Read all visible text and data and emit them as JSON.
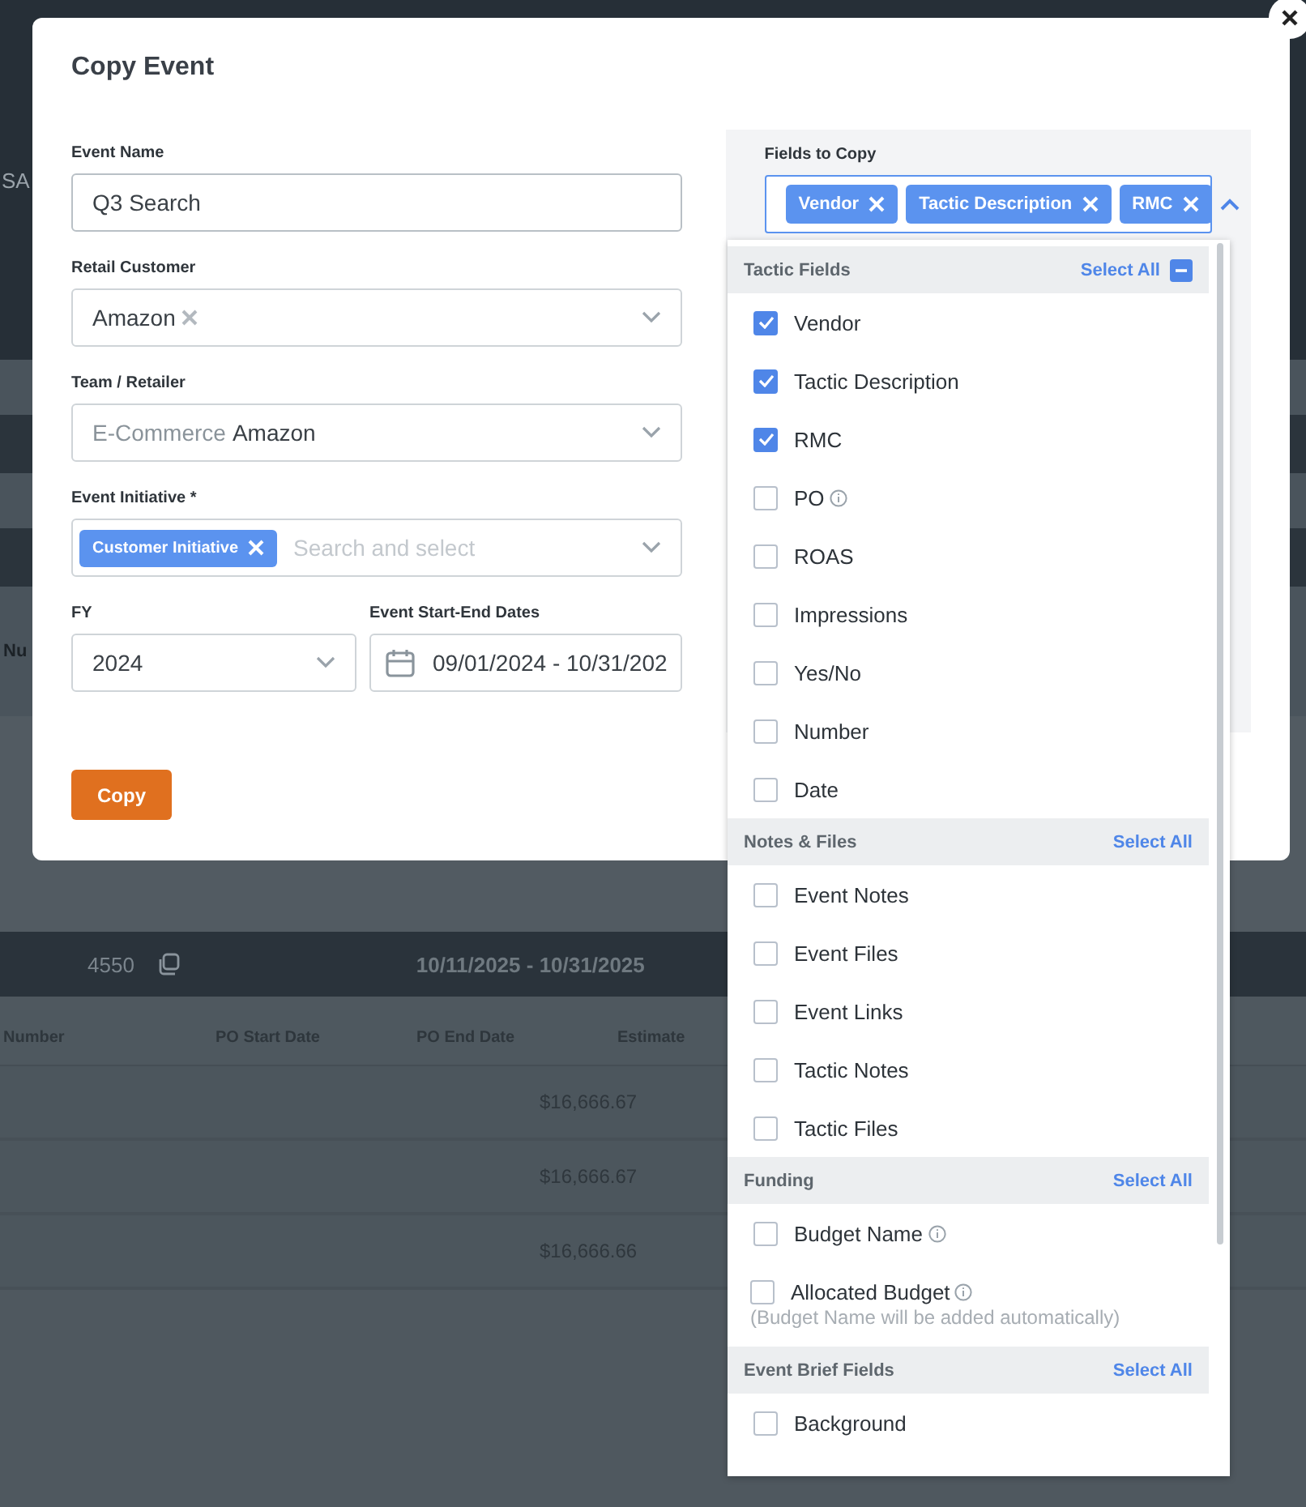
{
  "background": {
    "header_text": "SA",
    "column_text": "Nu",
    "event_bar": {
      "id": "4550",
      "dates": "10/11/2025 - 10/31/2025"
    },
    "table": {
      "columns": [
        "Number",
        "PO Start Date",
        "PO End Date",
        "Estimate"
      ],
      "rows": [
        {
          "estimate": "$16,666.67"
        },
        {
          "estimate": "$16,666.67"
        },
        {
          "estimate": "$16,666.66"
        }
      ]
    }
  },
  "dialog": {
    "title": "Copy Event",
    "fields": [
      {
        "kind": "text",
        "label": "Event Name",
        "value": "Q3 Search"
      },
      {
        "kind": "select",
        "label": "Retail Customer",
        "value": "Amazon",
        "clearable": true
      },
      {
        "kind": "select",
        "label": "Team / Retailer",
        "prefix": "E-Commerce",
        "value": "Amazon",
        "clearable": false
      },
      {
        "kind": "tags",
        "label": "Event Initiative *",
        "tags": [
          "Customer Initiative"
        ],
        "placeholder": "Search and select"
      },
      {
        "kind": "year",
        "label": "FY",
        "value": "2024"
      },
      {
        "kind": "daterange",
        "label": "Event Start-End Dates",
        "value": "09/01/2024 - 10/31/202"
      }
    ],
    "copy_button": "Copy"
  },
  "fields_to_copy": {
    "label": "Fields to Copy",
    "chips": [
      "Vendor",
      "Tactic Description",
      "RMC"
    ],
    "expanded": true,
    "groups": [
      {
        "title": "Tactic Fields",
        "select_all": "Select All",
        "partial": true,
        "items": [
          {
            "label": "Vendor",
            "checked": true,
            "info": false
          },
          {
            "label": "Tactic Description",
            "checked": true,
            "info": false
          },
          {
            "label": "RMC",
            "checked": true,
            "info": false
          },
          {
            "label": "PO",
            "checked": false,
            "info": true
          },
          {
            "label": "ROAS",
            "checked": false,
            "info": false
          },
          {
            "label": "Impressions",
            "checked": false,
            "info": false
          },
          {
            "label": "Yes/No",
            "checked": false,
            "info": false
          },
          {
            "label": "Number",
            "checked": false,
            "info": false
          },
          {
            "label": "Date",
            "checked": false,
            "info": false
          }
        ]
      },
      {
        "title": "Notes & Files",
        "select_all": "Select All",
        "partial": false,
        "items": [
          {
            "label": "Event Notes",
            "checked": false,
            "info": false
          },
          {
            "label": "Event Files",
            "checked": false,
            "info": false
          },
          {
            "label": "Event Links",
            "checked": false,
            "info": false
          },
          {
            "label": "Tactic Notes",
            "checked": false,
            "info": false
          },
          {
            "label": "Tactic Files",
            "checked": false,
            "info": false
          }
        ]
      },
      {
        "title": "Funding",
        "select_all": "Select All",
        "partial": false,
        "items": [
          {
            "label": "Budget Name",
            "checked": false,
            "info": true
          },
          {
            "label": "Allocated Budget",
            "checked": false,
            "info": true,
            "note": "(Budget Name will be added automatically)"
          }
        ]
      },
      {
        "title": "Event Brief Fields",
        "select_all": "Select All",
        "partial": false,
        "items": [
          {
            "label": "Background",
            "checked": false,
            "info": false
          }
        ]
      }
    ]
  }
}
